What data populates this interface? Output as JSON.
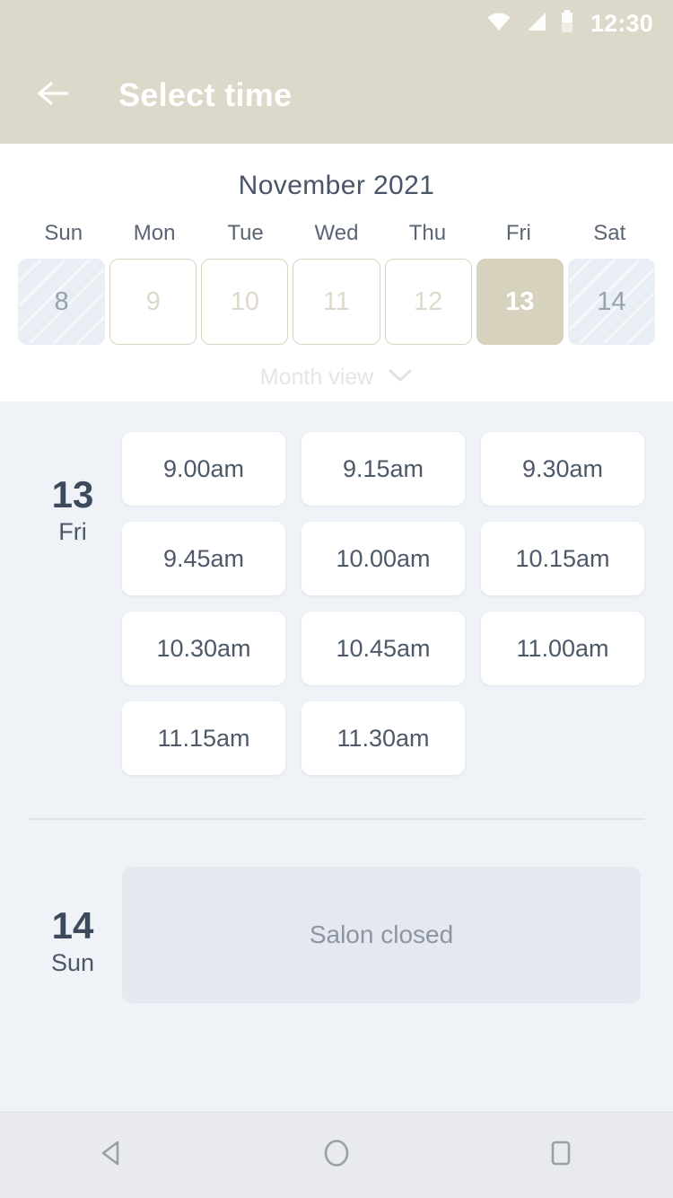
{
  "status_bar": {
    "time": "12:30",
    "icons": [
      "wifi-icon",
      "cellular-signal-icon",
      "battery-icon"
    ]
  },
  "app_bar": {
    "back_icon": "back-arrow-icon",
    "title": "Select time"
  },
  "calendar": {
    "month_title": "November 2021",
    "weekdays": [
      "Sun",
      "Mon",
      "Tue",
      "Wed",
      "Thu",
      "Fri",
      "Sat"
    ],
    "dates": [
      {
        "day": "8",
        "state": "closed"
      },
      {
        "day": "9",
        "state": "available"
      },
      {
        "day": "10",
        "state": "available"
      },
      {
        "day": "11",
        "state": "available"
      },
      {
        "day": "12",
        "state": "available"
      },
      {
        "day": "13",
        "state": "selected"
      },
      {
        "day": "14",
        "state": "closed"
      }
    ],
    "month_view_label": "Month view",
    "month_view_icon": "chevron-down-icon"
  },
  "days": [
    {
      "day_number": "13",
      "day_of_week": "Fri",
      "slots": [
        "9.00am",
        "9.15am",
        "9.30am",
        "9.45am",
        "10.00am",
        "10.15am",
        "10.30am",
        "10.45am",
        "11.00am",
        "11.15am",
        "11.30am"
      ]
    },
    {
      "day_number": "14",
      "day_of_week": "Sun",
      "closed_message": "Salon closed"
    }
  ],
  "nav_bar": {
    "back": "nav-back-icon",
    "home": "nav-home-icon",
    "recents": "nav-recents-icon"
  },
  "colors": {
    "header_bg": "#ddd9ca",
    "selected_date_bg": "#d7d2bd",
    "body_bg": "#eff2f7",
    "slot_bg": "#ffffff",
    "closed_panel_bg": "#e5e8ee",
    "text_dark": "#3d4a5c"
  }
}
